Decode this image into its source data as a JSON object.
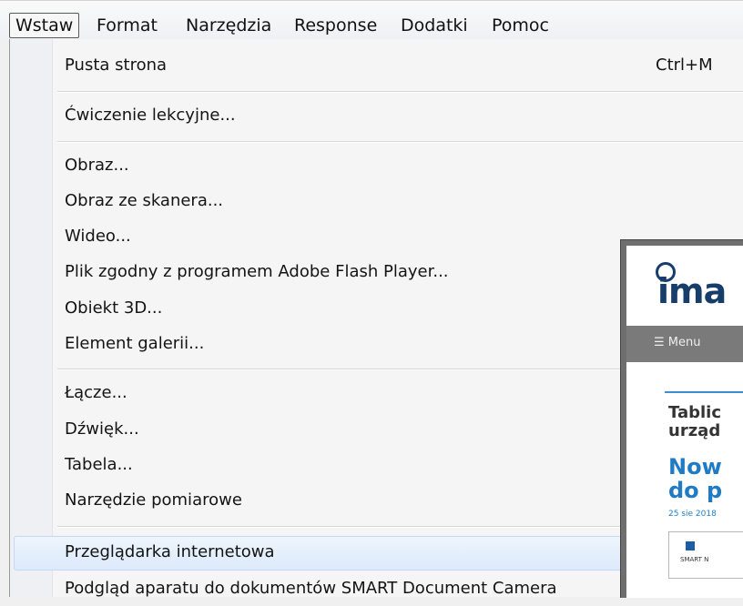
{
  "menubar": {
    "items": [
      "Wstaw",
      "Format",
      "Narzędzia",
      "Response",
      "Dodatki",
      "Pomoc"
    ],
    "active": "Wstaw"
  },
  "dropdown": {
    "items": [
      {
        "label": "Pusta strona",
        "shortcut": "Ctrl+M"
      },
      {
        "label": "Ćwiczenie lekcyjne..."
      },
      {
        "label": "Obraz..."
      },
      {
        "label": "Obraz ze skanera..."
      },
      {
        "label": "Wideo..."
      },
      {
        "label": "Plik zgodny z programem Adobe Flash Player..."
      },
      {
        "label": "Obiekt 3D..."
      },
      {
        "label": "Element galerii..."
      },
      {
        "label": "Łącze..."
      },
      {
        "label": "Dźwięk..."
      },
      {
        "label": "Tabela..."
      },
      {
        "label": "Narzędzie pomiarowe"
      },
      {
        "label": "Przeglądarka internetowa",
        "highlighted": true
      },
      {
        "label": "Podgląd aparatu do dokumentów SMART Document Camera"
      }
    ]
  },
  "preview": {
    "logo_text": "ima",
    "menu_label": "☰ Menu",
    "heading_line1": "Tablic",
    "heading_line2": "urząd",
    "news_line1": "Now",
    "news_line2": "do p",
    "date": "25 sie 2018",
    "thumb_brand": "SMART N"
  }
}
